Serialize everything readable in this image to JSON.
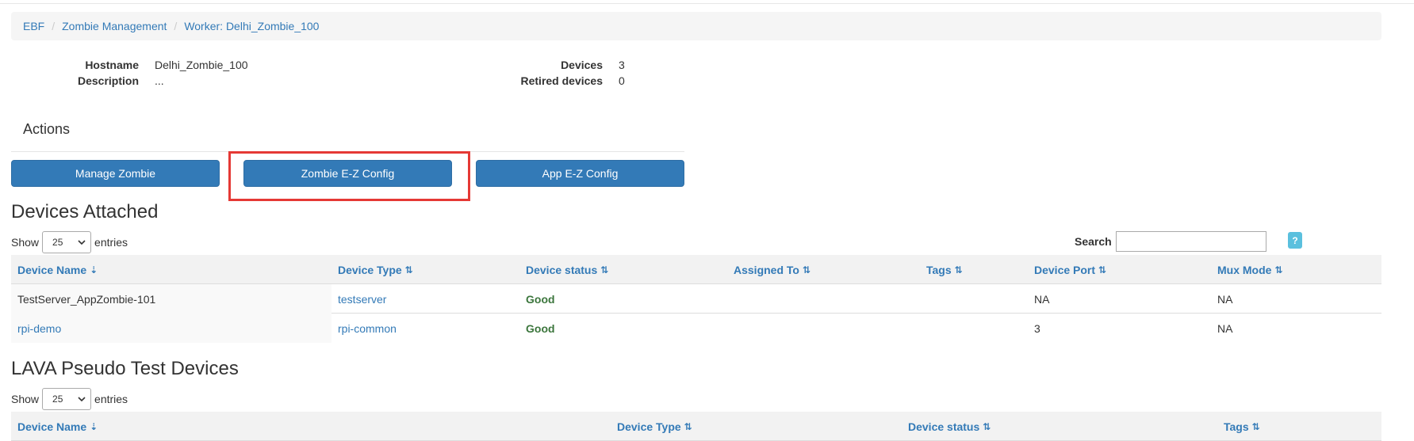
{
  "breadcrumb": [
    {
      "label": "EBF"
    },
    {
      "label": "Zombie Management"
    },
    {
      "label": "Worker: Delhi_Zombie_100"
    }
  ],
  "info": {
    "hostname_label": "Hostname",
    "hostname_value": "Delhi_Zombie_100",
    "description_label": "Description",
    "description_value": "...",
    "devices_label": "Devices",
    "devices_value": "3",
    "retired_label": "Retired devices",
    "retired_value": "0"
  },
  "actions": {
    "title": "Actions",
    "manage_label": "Manage Zombie",
    "zombie_config_label": "Zombie E-Z Config",
    "app_config_label": "App E-Z Config"
  },
  "devices_attached": {
    "title": "Devices Attached",
    "show_label": "Show",
    "entries_value": "25",
    "entries_label": "entries",
    "search_label": "Search",
    "search_value": "",
    "help_label": "?",
    "columns": [
      "Device Name",
      "Device Type",
      "Device status",
      "Assigned To",
      "Tags",
      "Device Port",
      "Mux Mode"
    ],
    "rows": [
      {
        "name": "TestServer_AppZombie-101",
        "type": "testserver",
        "status": "Good",
        "assigned": "",
        "tags": "",
        "port": "NA",
        "mux": "NA"
      },
      {
        "name": "rpi-demo",
        "type": "rpi-common",
        "status": "Good",
        "assigned": "",
        "tags": "",
        "port": "3",
        "mux": "NA"
      }
    ]
  },
  "lava_devices": {
    "title": "LAVA Pseudo Test Devices",
    "show_label": "Show",
    "entries_value": "25",
    "entries_label": "entries",
    "columns": [
      "Device Name",
      "Device Type",
      "Device status",
      "Tags"
    ]
  },
  "colors": {
    "primary": "#337ab7",
    "good": "#3c763d",
    "highlight": "#e53935",
    "help": "#5bc0de"
  }
}
